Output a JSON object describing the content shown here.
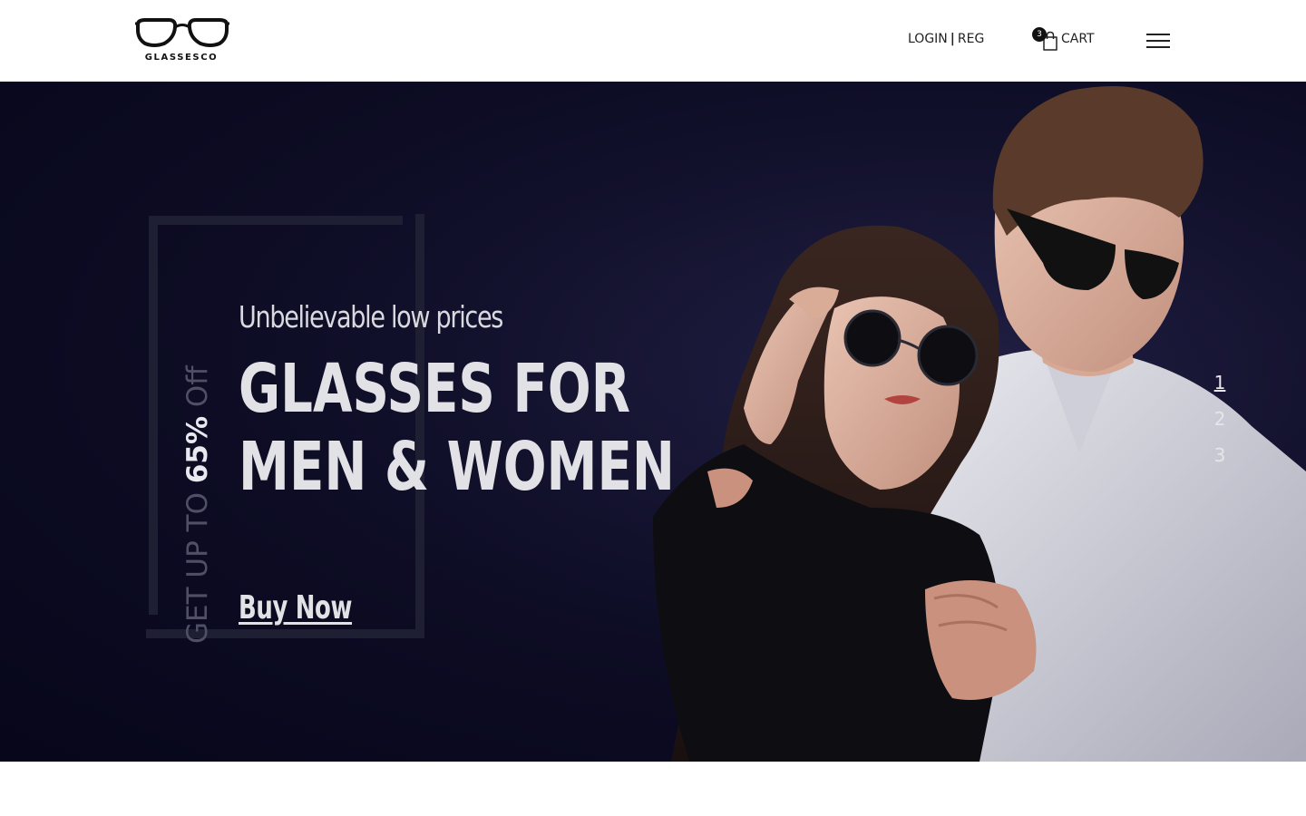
{
  "brand": {
    "name": "GLASSESCO"
  },
  "header": {
    "login_label": "LOGIN",
    "separator": "|",
    "register_label": "REG",
    "cart": {
      "count": "3",
      "label": "CART"
    }
  },
  "hero": {
    "promo": {
      "prefix": "GET UP TO ",
      "highlight": "65%",
      "suffix": " Off"
    },
    "subtitle": "Unbelievable low prices",
    "title_line1": "GLASSES FOR",
    "title_line2": "MEN & WOMEN",
    "cta": "Buy Now",
    "slides": [
      "1",
      "2",
      "3"
    ],
    "active_slide": "1"
  },
  "colors": {
    "hero_background": "#0d0c24",
    "hero_text": "#e2e2e6",
    "promo_muted": "#4f4f65",
    "frame": "#1f1f33"
  }
}
